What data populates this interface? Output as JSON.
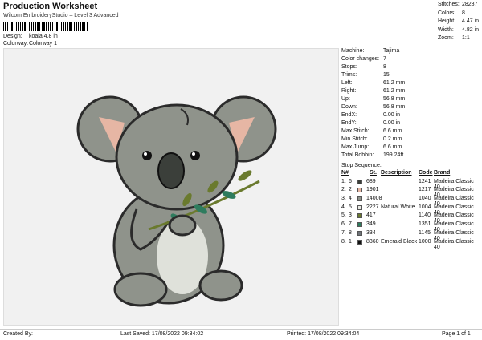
{
  "header": {
    "title": "Production Worksheet",
    "subtitle": "Wilcom EmbroideryStudio – Level 3 Advanced",
    "design_label": "Design:",
    "design_value": "koala 4,8 in",
    "colorway_label": "Colorway:",
    "colorway_value": "Colorway 1"
  },
  "summary": [
    {
      "label": "Stitches:",
      "value": "28287"
    },
    {
      "label": "Colors:",
      "value": "8"
    },
    {
      "label": "Height:",
      "value": "4.47 in"
    },
    {
      "label": "Width:",
      "value": "4.82 in"
    },
    {
      "label": "Zoom:",
      "value": "1:1"
    }
  ],
  "machine_info": [
    {
      "label": "Machine:",
      "value": "Tajima"
    },
    {
      "label": "Color changes:",
      "value": "7"
    },
    {
      "label": "Stops:",
      "value": "8"
    },
    {
      "label": "Trims:",
      "value": "15"
    },
    {
      "label": "Left:",
      "value": "61.2 mm"
    },
    {
      "label": "Right:",
      "value": "61.2 mm"
    },
    {
      "label": "Up:",
      "value": "56.8 mm"
    },
    {
      "label": "Down:",
      "value": "56.8 mm"
    },
    {
      "label": "EndX:",
      "value": "0.00 in"
    },
    {
      "label": "EndY:",
      "value": "0.00 in"
    },
    {
      "label": "Max Stitch:",
      "value": "6.6 mm"
    },
    {
      "label": "Min Stitch:",
      "value": "0.2 mm"
    },
    {
      "label": "Max Jump:",
      "value": "6.6 mm"
    },
    {
      "label": "Total Bobbin:",
      "value": "199.24ft"
    }
  ],
  "stop_sequence": {
    "title": "Stop Sequence:",
    "headers": [
      "N#",
      "St.",
      "Description",
      "Code",
      "Brand"
    ],
    "rows": [
      {
        "order": "1.",
        "n": "6",
        "color": "#3b3f3a",
        "st": "689",
        "desc": "",
        "code": "1241",
        "brand": "Madeira Classic 40"
      },
      {
        "order": "2.",
        "n": "2",
        "color": "#e6b6a4",
        "st": "1901",
        "desc": "",
        "code": "1217",
        "brand": "Madeira Classic 40"
      },
      {
        "order": "3.",
        "n": "4",
        "color": "#8f938b",
        "st": "14008",
        "desc": "",
        "code": "1040",
        "brand": "Madeira Classic 40"
      },
      {
        "order": "4.",
        "n": "5",
        "color": "#e9eae4",
        "st": "2227",
        "desc": "Natural White",
        "code": "1004",
        "brand": "Madeira Classic 40"
      },
      {
        "order": "5.",
        "n": "3",
        "color": "#6a7a2e",
        "st": "417",
        "desc": "",
        "code": "1140",
        "brand": "Madeira Classic 40"
      },
      {
        "order": "6.",
        "n": "7",
        "color": "#2e7c5e",
        "st": "349",
        "desc": "",
        "code": "1351",
        "brand": "Madeira Classic 40"
      },
      {
        "order": "7.",
        "n": "8",
        "color": "#6e7378",
        "st": "334",
        "desc": "",
        "code": "1145",
        "brand": "Madeira Classic 40"
      },
      {
        "order": "8.",
        "n": "1",
        "color": "#111111",
        "st": "8360",
        "desc": "Emerald Black",
        "code": "1000",
        "brand": "Madeira Classic 40"
      }
    ]
  },
  "footer": {
    "created_by": "Created By:",
    "last_saved": "Last Saved: 17/08/2022 09:34:02",
    "printed": "Printed: 17/08/2022 09:34:04",
    "page": "Page 1 of 1"
  }
}
